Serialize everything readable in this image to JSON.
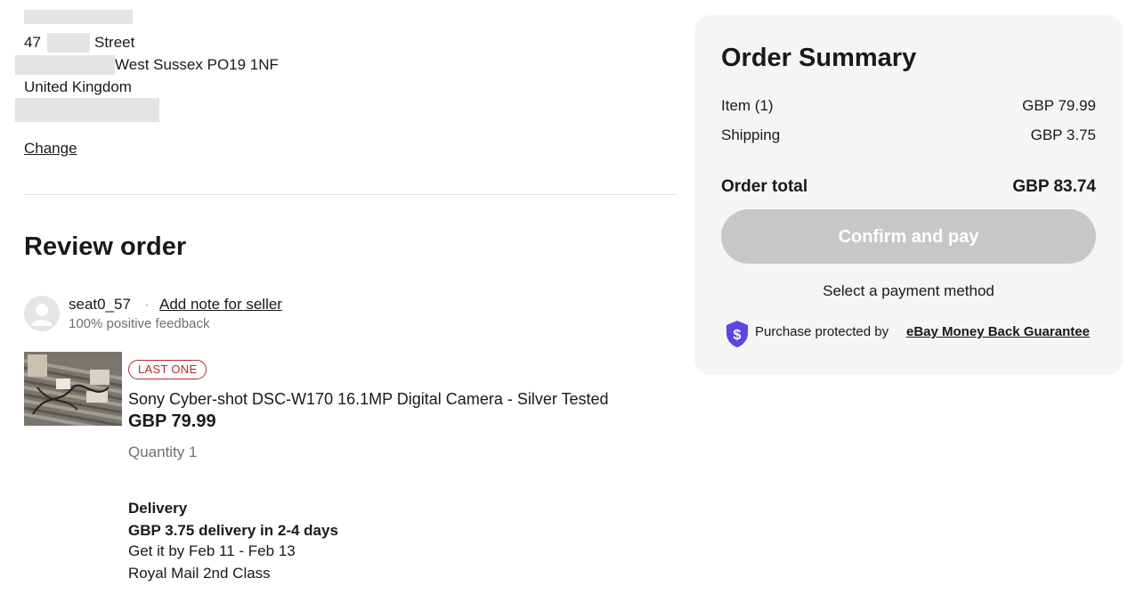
{
  "address": {
    "line1": "47",
    "line1b": "Street",
    "line2": "West Sussex PO19 1NF",
    "country": "United Kingdom",
    "change_link": "Change"
  },
  "review": {
    "heading": "Review order",
    "seller": {
      "name": "seat0_57",
      "separator": "·",
      "note_link": "Add note for seller",
      "feedback": "100% positive feedback"
    },
    "item": {
      "badge": "LAST ONE",
      "title": "Sony Cyber-shot DSC-W170 16.1MP Digital Camera - Silver Tested",
      "price": "GBP 79.99",
      "quantity": "Quantity 1"
    },
    "delivery": {
      "heading": "Delivery",
      "cost_line": "GBP 3.75 delivery in 2-4 days",
      "eta": "Get it by Feb 11 - Feb 13",
      "service": "Royal Mail 2nd Class"
    }
  },
  "summary": {
    "title": "Order Summary",
    "item_label": "Item (1)",
    "item_value": "GBP 79.99",
    "shipping_label": "Shipping",
    "shipping_value": "GBP 3.75",
    "total_label": "Order total",
    "total_value": "GBP 83.74",
    "confirm_button": "Confirm and pay",
    "payment_hint": "Select a payment method",
    "protection_text": "Purchase protected by",
    "protection_link": "eBay Money Back Guarantee"
  },
  "colors": {
    "badge_red": "#b32b2b",
    "shield_purple": "#5e44e0",
    "button_disabled": "#c7c7c7",
    "panel_bg": "#f5f5f5"
  },
  "icons": [
    "avatar-icon",
    "shield-dollar-icon"
  ]
}
